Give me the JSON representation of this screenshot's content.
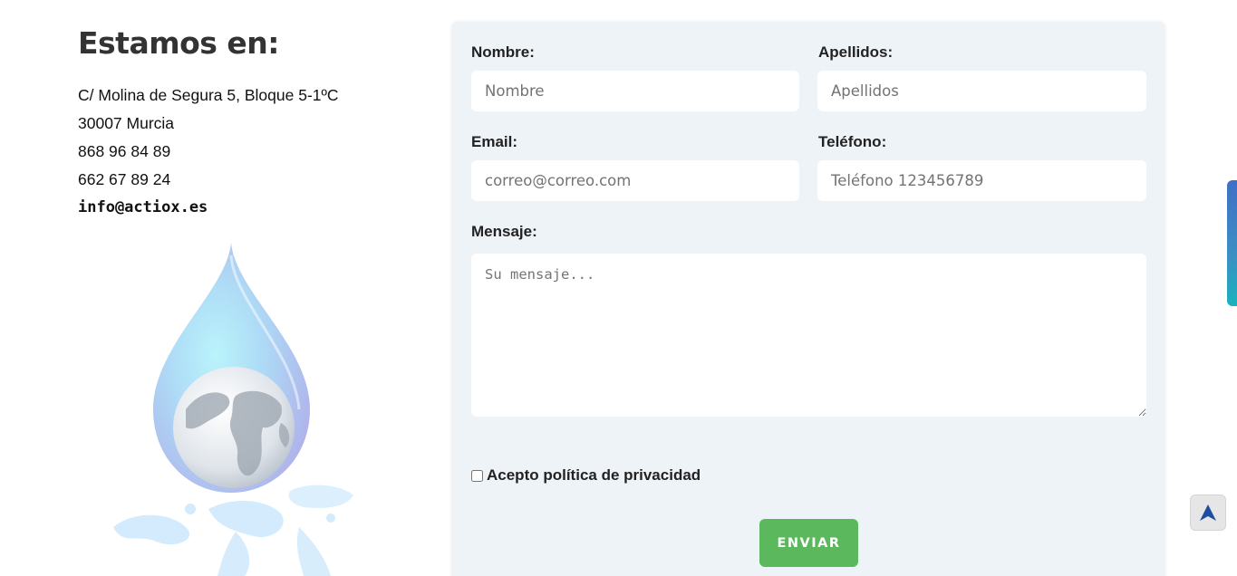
{
  "contact": {
    "title": "Estamos en:",
    "address": "C/ Molina de Segura 5, Bloque 5-1ºC",
    "city": "30007 Murcia",
    "phone1": "868 96 84 89",
    "phone2": "662 67 89 24",
    "email": "info@actiox.es"
  },
  "form": {
    "nombre_label": "Nombre:",
    "nombre_placeholder": "Nombre",
    "apellidos_label": "Apellidos:",
    "apellidos_placeholder": "Apellidos",
    "email_label": "Email:",
    "email_placeholder": "correo@correo.com",
    "telefono_label": "Teléfono:",
    "telefono_placeholder": "Teléfono 123456789",
    "mensaje_label": "Mensaje:",
    "mensaje_placeholder": "Su mensaje...",
    "privacy_label": "Acepto política de privacidad",
    "submit_label": "ENVIAR"
  },
  "icons": {
    "illustration": "water-drop-globe-illustration",
    "back_to_top": "arrow-up-icon"
  },
  "colors": {
    "submit": "#5cb85c",
    "card": "#eef3f8",
    "scroll_indicator": "#3d8fc2",
    "arrow": "#1d4fa0"
  }
}
